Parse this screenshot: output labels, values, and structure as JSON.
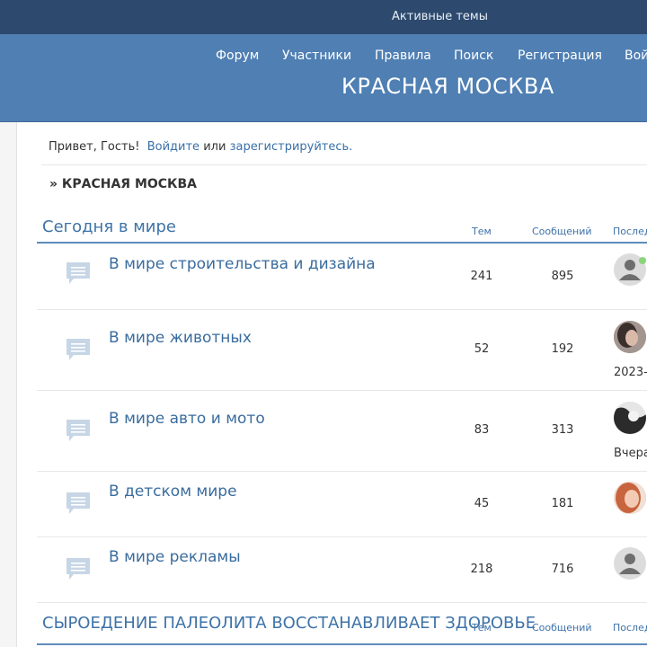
{
  "topbar": {
    "active_topics": "Активные темы"
  },
  "nav": {
    "items": [
      {
        "label": "Форум"
      },
      {
        "label": "Участники"
      },
      {
        "label": "Правила"
      },
      {
        "label": "Поиск"
      },
      {
        "label": "Регистрация"
      },
      {
        "label": "Вой"
      }
    ]
  },
  "site": {
    "title": "КРАСНАЯ МОСКВА"
  },
  "greeting": {
    "hello": "Привет, Гость!",
    "login_link": "Войдите",
    "or": "или",
    "register_link": "зарегистрируйтесь."
  },
  "breadcrumb": {
    "text": "» КРАСНАЯ МОСКВА"
  },
  "categories": [
    {
      "title": "Сегодня в мире",
      "col_topics": "Тем",
      "col_posts": "Сообщений",
      "col_last": "Послед",
      "forums": [
        {
          "name": "В мире строительства и дизайна",
          "topics": "241",
          "posts": "895",
          "last_date": "",
          "avatar": "default-avatar-icon",
          "online": true
        },
        {
          "name": "В мире животных",
          "topics": "52",
          "posts": "192",
          "last_date": "2023-",
          "avatar": "user-photo-woman-dark-hair",
          "online": false
        },
        {
          "name": "В мире авто и мото",
          "topics": "83",
          "posts": "313",
          "last_date": "Вчера",
          "avatar": "user-photo-black-white",
          "online": false
        },
        {
          "name": "В детском мире",
          "topics": "45",
          "posts": "181",
          "last_date": "",
          "avatar": "user-photo-redhead",
          "online": false
        },
        {
          "name": "В мире рекламы",
          "topics": "218",
          "posts": "716",
          "last_date": "",
          "avatar": "default-avatar-icon",
          "online": false
        }
      ]
    },
    {
      "title": "СЫРОЕДЕНИЕ ПАЛЕОЛИТА ВОССТАНАВЛИВАЕТ ЗДОРОВЬЕ",
      "col_topics": "Тем",
      "col_posts": "Сообщений",
      "col_last": "Послед",
      "forums": []
    }
  ],
  "colors": {
    "topbar_bg": "#2d4a6e",
    "header_bg": "#4f7fb3",
    "link": "#3a6c9e",
    "category_title": "#3f73a8",
    "online": "#8bd47a"
  }
}
